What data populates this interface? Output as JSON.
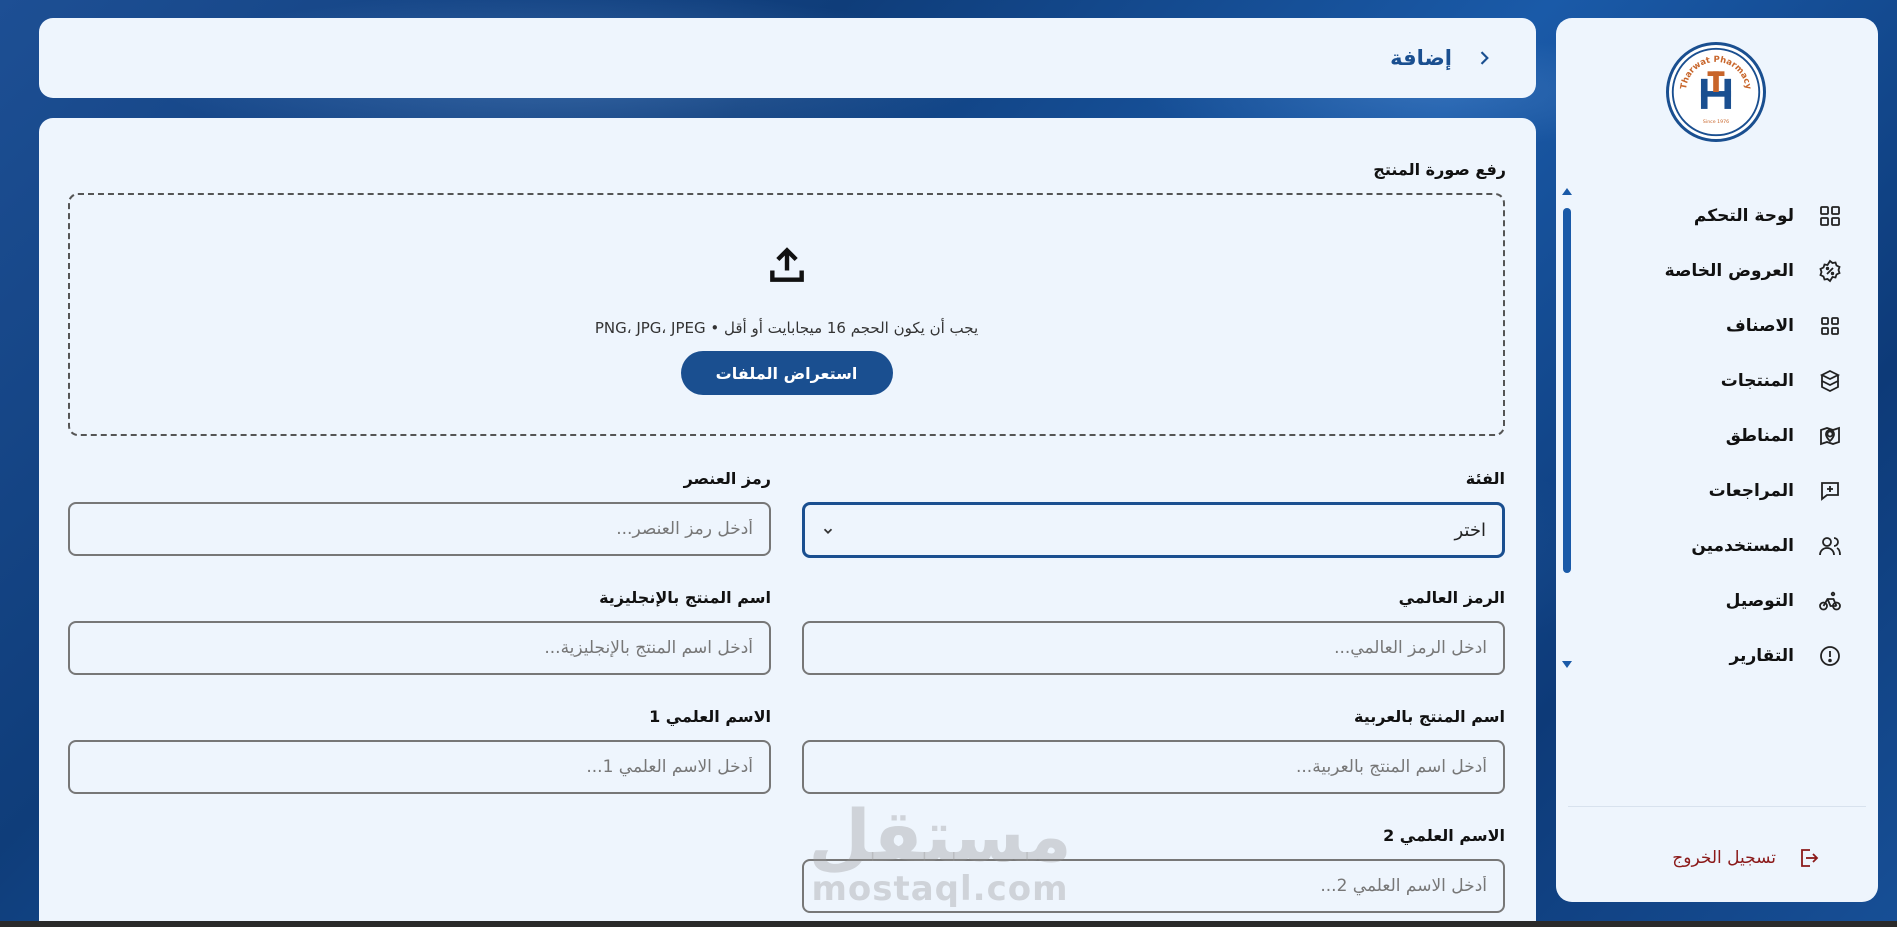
{
  "brand": {
    "logo_text": "Tharwat Pharmacy",
    "logo_since": "Since 1976",
    "colors": {
      "primary": "#1a4f90",
      "panel": "#eef5fd",
      "logout": "#8b1a1a"
    }
  },
  "sidebar": {
    "items": [
      {
        "label": "لوحة التحكم",
        "icon": "dashboard-icon"
      },
      {
        "label": "العروض الخاصة",
        "icon": "discount-badge-icon"
      },
      {
        "label": "الاصناف",
        "icon": "categories-grid-icon"
      },
      {
        "label": "المنتجات",
        "icon": "cubes-icon"
      },
      {
        "label": "المناطق",
        "icon": "map-pin-icon"
      },
      {
        "label": "المراجعات",
        "icon": "message-plus-icon"
      },
      {
        "label": "المستخدمين",
        "icon": "users-icon"
      },
      {
        "label": "التوصيل",
        "icon": "bicycle-icon"
      },
      {
        "label": "التقارير",
        "icon": "alert-circle-icon"
      }
    ],
    "logout_label": "تسجيل الخروج"
  },
  "header": {
    "title": "إضافة"
  },
  "form": {
    "upload": {
      "label": "رفع صورة المنتج",
      "hint": "يجب أن يكون الحجم 16 ميجابايت أو أقل • PNG، JPG، JPEG",
      "button": "استعراض الملفات"
    },
    "category": {
      "label": "الفئة",
      "value": "اختر"
    },
    "item_code": {
      "label": "رمز العنصر",
      "placeholder": "أدخل رمز العنصر..."
    },
    "global_code": {
      "label": "الرمز العالمي",
      "placeholder": "ادخل الرمز العالمي..."
    },
    "name_en": {
      "label": "اسم المنتج بالإنجليزية",
      "placeholder": "أدخل اسم المنتج بالإنجليزية..."
    },
    "name_ar": {
      "label": "اسم المنتج بالعربية",
      "placeholder": "أدخل اسم المنتج بالعربية..."
    },
    "sci_name_1": {
      "label": "الاسم العلمي 1",
      "placeholder": "أدخل الاسم العلمي 1..."
    },
    "sci_name_2": {
      "label": "الاسم العلمي 2",
      "placeholder": "أدخل الاسم العلمي 2..."
    }
  },
  "watermark": {
    "arabic": "مستقل",
    "latin": "mostaql.com"
  }
}
